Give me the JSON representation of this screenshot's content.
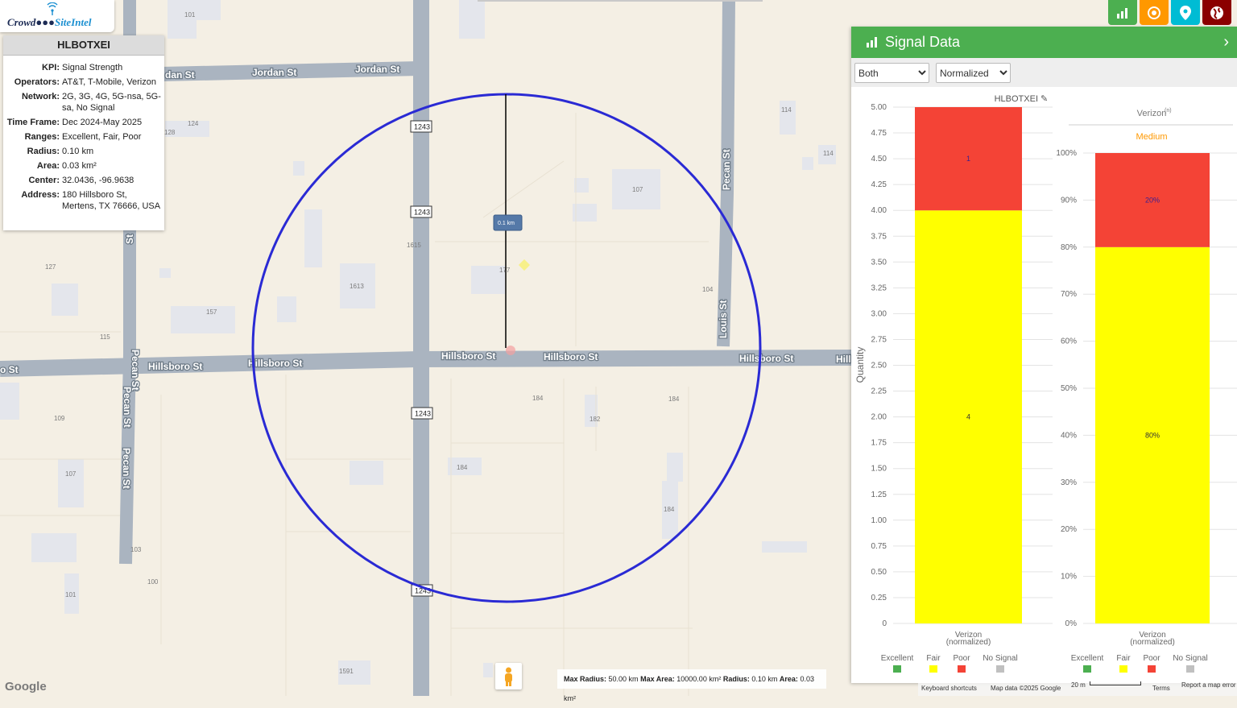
{
  "app": {
    "logo_prefix": "Crowd",
    "logo_suffix": "SiteIntel"
  },
  "info": {
    "title": "HLBOTXEI",
    "rows": [
      {
        "key": "KPI:",
        "value": "Signal Strength"
      },
      {
        "key": "Operators:",
        "value": "AT&T, T-Mobile, Verizon"
      },
      {
        "key": "Network:",
        "value": "2G, 3G, 4G, 5G-nsa, 5G-sa, No Signal"
      },
      {
        "key": "Time Frame:",
        "value": "Dec 2024-May 2025"
      },
      {
        "key": "Ranges:",
        "value": "Excellent, Fair, Poor"
      },
      {
        "key": "Radius:",
        "value": "0.10 km"
      },
      {
        "key": "Area:",
        "value": "0.03 km²"
      },
      {
        "key": "Center:",
        "value": "32.0436, -96.9638"
      },
      {
        "key": "Address:",
        "value": "180 Hillsboro St, Mertens, TX 76666, USA"
      }
    ]
  },
  "map": {
    "streets": [
      "Jordan St",
      "Jordan St",
      "dan St",
      "Hillsboro St",
      "Hillsboro St",
      "Hillsboro St",
      "Hillsboro St",
      "Hillsboro St",
      "Hill",
      "o St",
      "Pecan St",
      "Pecan St",
      "Pecan St",
      "St",
      "Pecan St",
      "Louis St"
    ],
    "shield": "1243",
    "numbers": [
      "101",
      "124",
      "128",
      "114",
      "114",
      "107",
      "127",
      "157",
      "1613",
      "1615",
      "177",
      "115",
      "104",
      "184",
      "182",
      "184",
      "109",
      "107",
      "184",
      "184",
      "103",
      "100",
      "101",
      "1591"
    ],
    "radius_label": "0.1 km",
    "colors": {
      "circle": "#2a2ad4"
    }
  },
  "bottom_info": {
    "max_radius_label": "Max Radius:",
    "max_radius": "50.00 km",
    "max_area_label": "Max Area:",
    "max_area": "10000.00 km²",
    "radius_label": "Radius:",
    "radius": "0.10 km",
    "area_label": "Area:",
    "area": "0.03 km²"
  },
  "footer": {
    "shortcuts": "Keyboard shortcuts",
    "mapdata": "Map data ©2025 Google",
    "scale": "20 m",
    "terms": "Terms",
    "report": "Report a map error"
  },
  "google": "Google",
  "toolbar": {
    "buttons": [
      {
        "icon": "bar-chart-icon",
        "color": "#4caf50"
      },
      {
        "icon": "target-icon",
        "color": "#ff9800"
      },
      {
        "icon": "location-pin-icon",
        "color": "#00bcd4"
      },
      {
        "icon": "globe-icon",
        "color": "#8b0000"
      }
    ]
  },
  "panel": {
    "title": "Signal Data",
    "select1": {
      "value": "Both",
      "options": [
        "Both"
      ]
    },
    "select2": {
      "value": "Normalized",
      "options": [
        "Normalized"
      ]
    },
    "colors": {
      "Excellent": "#4caf50",
      "Fair": "#ffff00",
      "Poor": "#f44336",
      "No Signal": "#c0c0c0"
    }
  },
  "chart_data": [
    {
      "type": "bar",
      "stacked": true,
      "title": "HLBOTXEI",
      "ylabel": "Quantity",
      "ylim": [
        0,
        5
      ],
      "yticks": [
        "0",
        "0.25",
        "0.50",
        "0.75",
        "1.00",
        "1.25",
        "1.50",
        "1.75",
        "2.00",
        "2.25",
        "2.50",
        "2.75",
        "3.00",
        "3.25",
        "3.50",
        "3.75",
        "4.00",
        "4.25",
        "4.50",
        "4.75",
        "5.00"
      ],
      "categories": [
        "Verizon (normalized)"
      ],
      "series": [
        {
          "name": "Excellent",
          "values": [
            0
          ]
        },
        {
          "name": "Fair",
          "values": [
            4
          ]
        },
        {
          "name": "Poor",
          "values": [
            1
          ]
        },
        {
          "name": "No Signal",
          "values": [
            0
          ]
        }
      ],
      "data_labels": [
        "4",
        "1"
      ],
      "legend": [
        "Excellent",
        "Fair",
        "Poor",
        "No Signal"
      ]
    },
    {
      "type": "bar",
      "stacked": true,
      "title": "Verizon",
      "title_sup": "(n)",
      "subtitle": "Medium",
      "subtitle_color": "#ff9800",
      "ylim": [
        0,
        100
      ],
      "yticks": [
        "0%",
        "10%",
        "20%",
        "30%",
        "40%",
        "50%",
        "60%",
        "70%",
        "80%",
        "90%",
        "100%"
      ],
      "categories": [
        "Verizon (normalized)"
      ],
      "series": [
        {
          "name": "Excellent",
          "values": [
            0
          ]
        },
        {
          "name": "Fair",
          "values": [
            80
          ]
        },
        {
          "name": "Poor",
          "values": [
            20
          ]
        },
        {
          "name": "No Signal",
          "values": [
            0
          ]
        }
      ],
      "data_labels": [
        "80%",
        "20%"
      ],
      "legend": [
        "Excellent",
        "Fair",
        "Poor",
        "No Signal"
      ]
    }
  ]
}
